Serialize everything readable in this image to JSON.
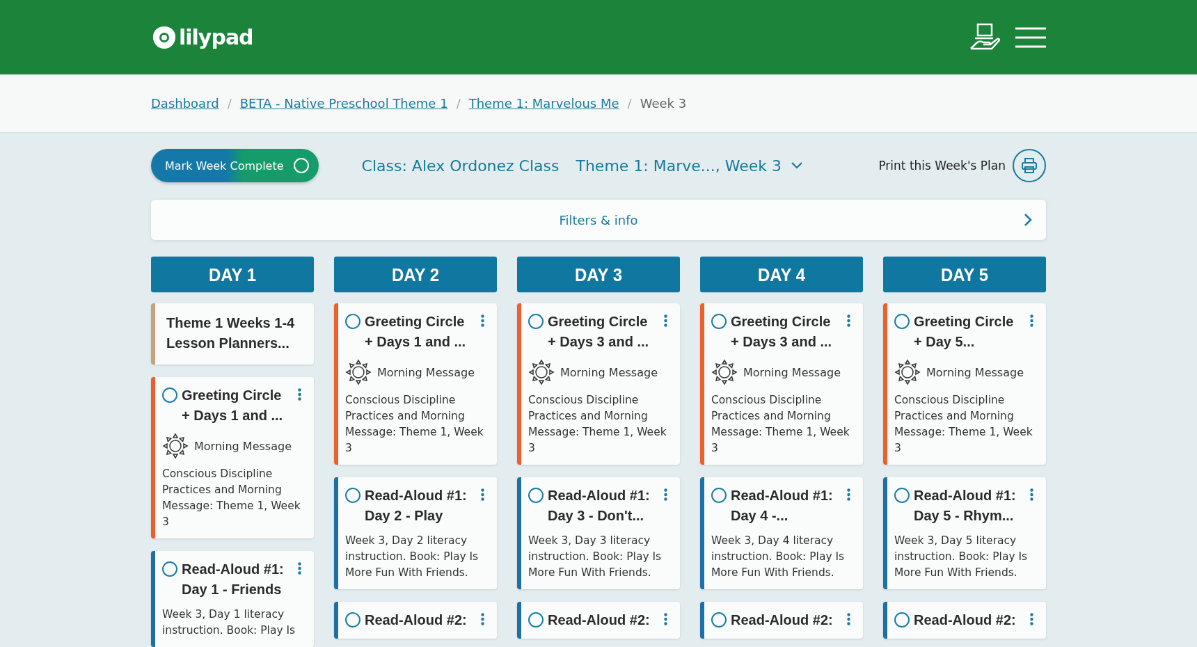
{
  "header": {
    "logo": "lilypad"
  },
  "breadcrumb": {
    "separator": "/",
    "items": [
      {
        "label": "Dashboard",
        "link": true
      },
      {
        "label": "BETA - Native Preschool Theme 1",
        "link": true
      },
      {
        "label": "Theme 1: Marvelous Me",
        "link": true
      },
      {
        "label": "Week 3",
        "link": false
      }
    ]
  },
  "toolbar": {
    "mark_complete": {
      "label": "Mark Week Complete",
      "checked": false
    },
    "class_label": "Class: Alex Ordonez Class",
    "week_select": "Theme 1: Marve..., Week 3",
    "print": "Print this Week's Plan"
  },
  "filters": {
    "label": "Filters & info"
  },
  "days": [
    {
      "title": "DAY 1",
      "cards": [
        {
          "kind": "note",
          "color": "#c9a07c",
          "title": "Theme 1 Weeks 1-4\nLesson Planners..."
        },
        {
          "kind": "activity",
          "color": "#ef5f2c",
          "checked": false,
          "title": "Greeting Circle\n+ Days 1 and ...",
          "tag": "Morning Message",
          "text": "Conscious Discipline Practices and Morning Message: Theme 1, Week 3"
        },
        {
          "kind": "activity",
          "color": "#1d6fa6",
          "checked": false,
          "title": "Read-Aloud #1:\nDay 1 - Friends",
          "text": "Week 3, Day 1 literacy instruction. Book: Play Is"
        }
      ]
    },
    {
      "title": "DAY 2",
      "cards": [
        {
          "kind": "activity",
          "color": "#ef5f2c",
          "checked": false,
          "title": "Greeting Circle\n+ Days 1 and ...",
          "tag": "Morning Message",
          "text": "Conscious Discipline Practices and Morning Message: Theme 1, Week 3"
        },
        {
          "kind": "activity",
          "color": "#1d6fa6",
          "checked": false,
          "title": "Read-Aloud #1:\nDay 2 - Play",
          "text": "Week 3, Day 2 literacy instruction. Book: Play Is More Fun With Friends."
        },
        {
          "kind": "activity",
          "color": "#1d6fa6",
          "checked": false,
          "title": "Read-Aloud #2:"
        }
      ]
    },
    {
      "title": "DAY 3",
      "cards": [
        {
          "kind": "activity",
          "color": "#ef5f2c",
          "checked": false,
          "title": "Greeting Circle\n+ Days 3 and ...",
          "tag": "Morning Message",
          "text": "Conscious Discipline Practices and Morning Message: Theme 1, Week 3"
        },
        {
          "kind": "activity",
          "color": "#1d6fa6",
          "checked": false,
          "title": "Read-Aloud #1:\nDay 3 - Don't...",
          "text": "Week 3, Day 3 literacy instruction. Book: Play Is More Fun With Friends."
        },
        {
          "kind": "activity",
          "color": "#1d6fa6",
          "checked": false,
          "title": "Read-Aloud #2:"
        }
      ]
    },
    {
      "title": "DAY 4",
      "cards": [
        {
          "kind": "activity",
          "color": "#ef5f2c",
          "checked": false,
          "title": "Greeting Circle\n+ Days 3 and ...",
          "tag": "Morning Message",
          "text": "Conscious Discipline Practices and Morning Message: Theme 1, Week 3"
        },
        {
          "kind": "activity",
          "color": "#1d6fa6",
          "checked": false,
          "title": "Read-Aloud #1:\nDay 4 -...",
          "text": "Week 3, Day 4 literacy instruction. Book: Play Is More Fun With Friends."
        },
        {
          "kind": "activity",
          "color": "#1d6fa6",
          "checked": false,
          "title": "Read-Aloud #2:"
        }
      ]
    },
    {
      "title": "DAY 5",
      "cards": [
        {
          "kind": "activity",
          "color": "#ef5f2c",
          "checked": false,
          "title": "Greeting Circle\n+ Day 5...",
          "tag": "Morning Message",
          "text": "Conscious Discipline Practices and Morning Message: Theme 1, Week 3"
        },
        {
          "kind": "activity",
          "color": "#1d6fa6",
          "checked": false,
          "title": "Read-Aloud #1:\nDay 5 - Rhym...",
          "text": "Week 3, Day 5 literacy instruction. Book: Play Is More Fun With Friends."
        },
        {
          "kind": "activity",
          "color": "#1d6fa6",
          "checked": false,
          "title": "Read-Aloud #2:"
        }
      ]
    }
  ]
}
